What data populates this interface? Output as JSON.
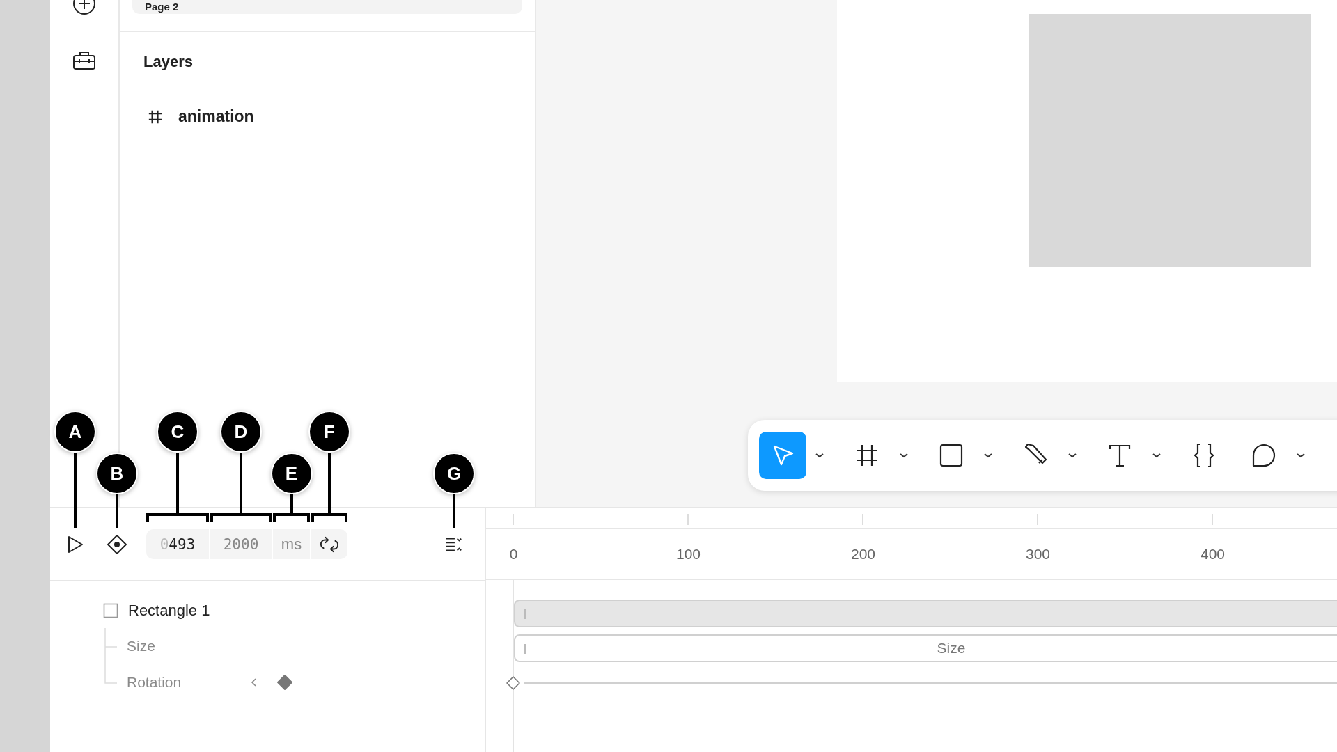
{
  "pages": [
    {
      "name": "Page 2",
      "selected": true
    }
  ],
  "layers": {
    "title": "Layers",
    "items": [
      {
        "name": "animation",
        "kind": "frame"
      }
    ]
  },
  "toolbar": {
    "tools": [
      {
        "kind": "select",
        "selected": true,
        "dropdown": true
      },
      {
        "kind": "frame",
        "selected": false,
        "dropdown": true
      },
      {
        "kind": "rectangle",
        "selected": false,
        "dropdown": true
      },
      {
        "kind": "pen",
        "selected": false,
        "dropdown": true
      },
      {
        "kind": "text",
        "selected": false,
        "dropdown": true
      },
      {
        "kind": "code",
        "selected": false,
        "dropdown": false
      },
      {
        "kind": "comment",
        "selected": false,
        "dropdown": true
      }
    ]
  },
  "timeline": {
    "controls": [
      {
        "kind": "play",
        "callout": "A"
      },
      {
        "kind": "keyframe",
        "callout": "B"
      },
      {
        "kind": "current_time",
        "dim": "0",
        "value": "493",
        "callout": "C"
      },
      {
        "kind": "duration",
        "value": "2000",
        "callout": "D"
      },
      {
        "kind": "unit",
        "value": "ms",
        "callout": "E"
      },
      {
        "kind": "loop",
        "callout": "F"
      },
      {
        "kind": "options",
        "callout": "G"
      }
    ],
    "ruler": [
      "0",
      "100",
      "200",
      "300",
      "400"
    ],
    "layers": [
      {
        "name": "Rectangle 1",
        "kind": "layer",
        "children": [
          {
            "name": "Size",
            "kind": "property",
            "keyframe_nav": false
          },
          {
            "name": "Rotation",
            "kind": "property",
            "keyframe_nav": true
          }
        ]
      }
    ],
    "tracks": [
      {
        "kind": "layer_bar"
      },
      {
        "kind": "property_bar",
        "label": "Size"
      },
      {
        "kind": "keyframe_line"
      }
    ]
  }
}
